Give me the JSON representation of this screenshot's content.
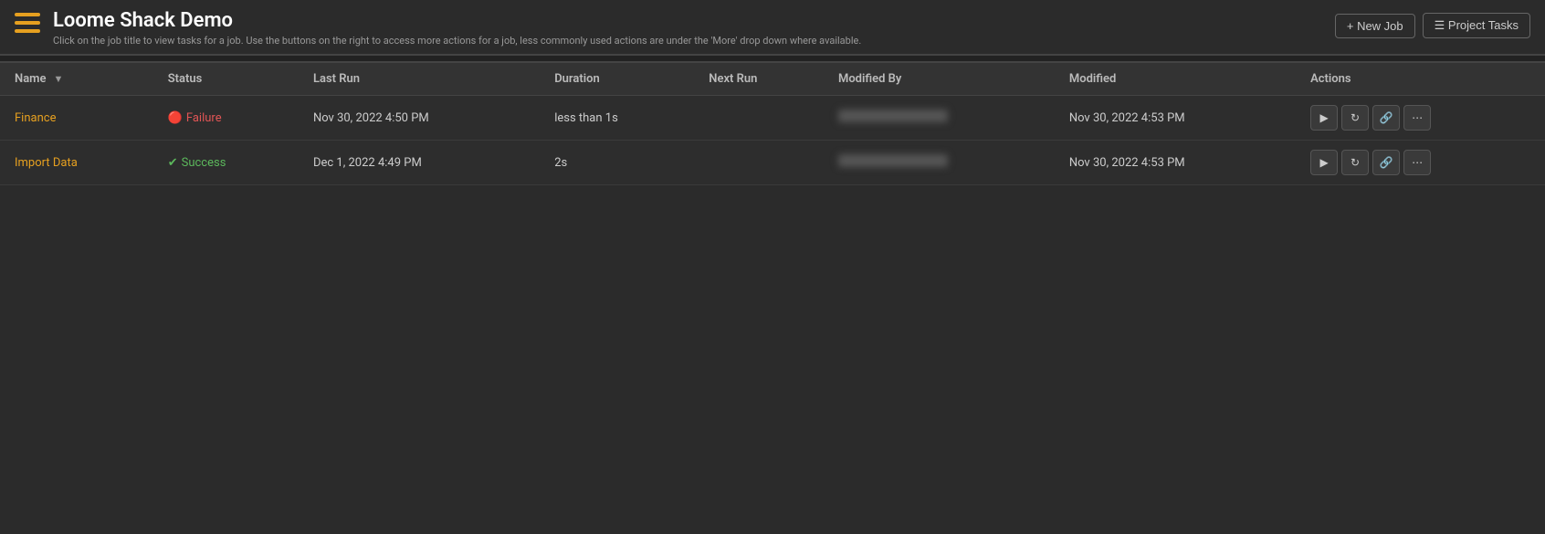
{
  "header": {
    "app_title": "Loome Shack Demo",
    "app_subtitle": "Click on the job title to view tasks for a job. Use the buttons on the right to access more actions for a job, less commonly used actions are under the 'More' drop down where available.",
    "hamburger_icon": "menu-icon",
    "new_job_label": "+ New Job",
    "project_tasks_label": "☰ Project Tasks"
  },
  "table": {
    "columns": [
      {
        "key": "name",
        "label": "Name",
        "has_filter": true
      },
      {
        "key": "status",
        "label": "Status"
      },
      {
        "key": "last_run",
        "label": "Last Run"
      },
      {
        "key": "duration",
        "label": "Duration"
      },
      {
        "key": "next_run",
        "label": "Next Run"
      },
      {
        "key": "modified_by",
        "label": "Modified By"
      },
      {
        "key": "modified",
        "label": "Modified"
      },
      {
        "key": "actions",
        "label": "Actions"
      }
    ],
    "rows": [
      {
        "id": "finance",
        "name": "Finance",
        "status": "Failure",
        "status_type": "failure",
        "last_run": "Nov 30, 2022 4:50 PM",
        "duration": "less than 1s",
        "next_run": "",
        "modified_by": "REDACTED",
        "modified": "Nov 30, 2022 4:53 PM"
      },
      {
        "id": "import-data",
        "name": "Import Data",
        "status": "Success",
        "status_type": "success",
        "last_run": "Dec 1, 2022 4:49 PM",
        "duration": "2s",
        "next_run": "",
        "modified_by": "REDACTED",
        "modified": "Nov 30, 2022 4:53 PM"
      }
    ],
    "action_buttons": {
      "run_label": "▶",
      "retry_label": "↺",
      "link_label": "⊙",
      "more_label": "···"
    }
  }
}
